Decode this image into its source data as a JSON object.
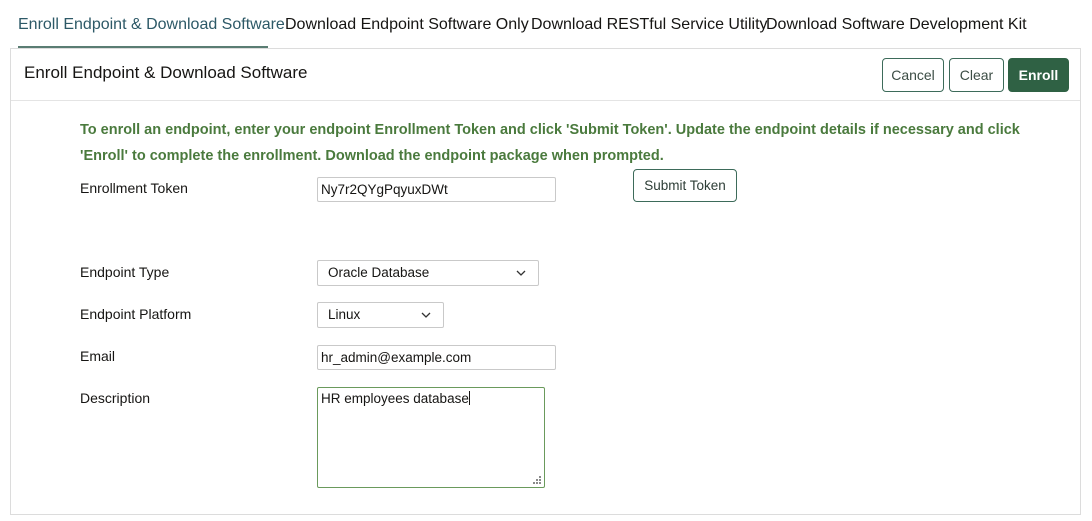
{
  "tabs": [
    {
      "label": "Enroll Endpoint & Download Software",
      "active": true
    },
    {
      "label": "Download Endpoint Software Only",
      "active": false
    },
    {
      "label": "Download RESTful Service Utility",
      "active": false
    },
    {
      "label": "Download Software Development Kit",
      "active": false
    }
  ],
  "panel": {
    "title": "Enroll Endpoint & Download Software",
    "buttons": {
      "cancel": "Cancel",
      "clear": "Clear",
      "enroll": "Enroll"
    },
    "instructions": "To enroll an endpoint, enter your endpoint Enrollment Token and click 'Submit Token'. Update the endpoint details if necessary and click 'Enroll' to complete the enrollment. Download the endpoint package when prompted."
  },
  "form": {
    "enrollment_token": {
      "label": "Enrollment Token",
      "value": "Ny7r2QYgPqyuxDWt"
    },
    "submit_token_label": "Submit Token",
    "endpoint_type": {
      "label": "Endpoint Type",
      "selected": "Oracle Database"
    },
    "endpoint_platform": {
      "label": "Endpoint Platform",
      "selected": "Linux"
    },
    "email": {
      "label": "Email",
      "value": "hr_admin@example.com"
    },
    "description": {
      "label": "Description",
      "value": "HR employees database"
    }
  },
  "colors": {
    "accent_green": "#2f6144",
    "instruction_text": "#4a7a3d",
    "active_tab_text": "#2d5967"
  }
}
